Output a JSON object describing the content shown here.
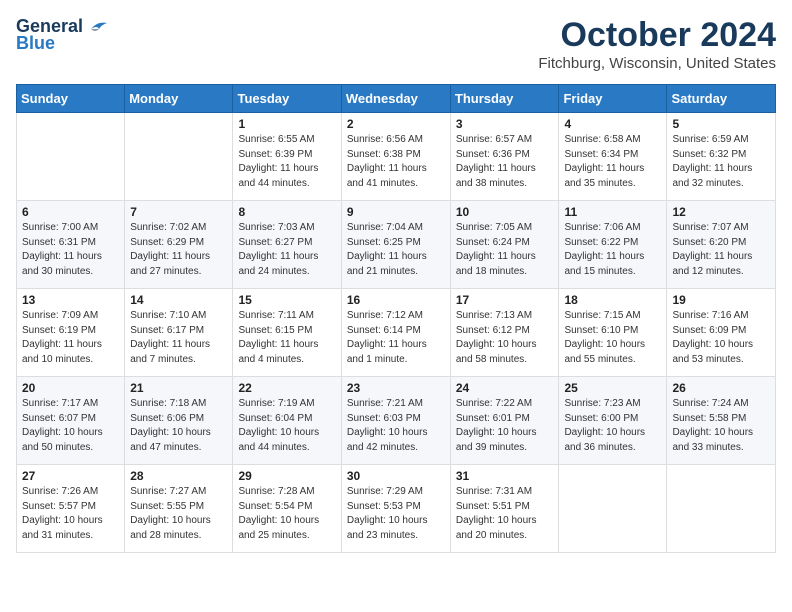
{
  "header": {
    "logo_general": "General",
    "logo_blue": "Blue",
    "month": "October 2024",
    "location": "Fitchburg, Wisconsin, United States"
  },
  "days_of_week": [
    "Sunday",
    "Monday",
    "Tuesday",
    "Wednesday",
    "Thursday",
    "Friday",
    "Saturday"
  ],
  "weeks": [
    [
      {
        "day": "",
        "sunrise": "",
        "sunset": "",
        "daylight": ""
      },
      {
        "day": "",
        "sunrise": "",
        "sunset": "",
        "daylight": ""
      },
      {
        "day": "1",
        "sunrise": "Sunrise: 6:55 AM",
        "sunset": "Sunset: 6:39 PM",
        "daylight": "Daylight: 11 hours and 44 minutes."
      },
      {
        "day": "2",
        "sunrise": "Sunrise: 6:56 AM",
        "sunset": "Sunset: 6:38 PM",
        "daylight": "Daylight: 11 hours and 41 minutes."
      },
      {
        "day": "3",
        "sunrise": "Sunrise: 6:57 AM",
        "sunset": "Sunset: 6:36 PM",
        "daylight": "Daylight: 11 hours and 38 minutes."
      },
      {
        "day": "4",
        "sunrise": "Sunrise: 6:58 AM",
        "sunset": "Sunset: 6:34 PM",
        "daylight": "Daylight: 11 hours and 35 minutes."
      },
      {
        "day": "5",
        "sunrise": "Sunrise: 6:59 AM",
        "sunset": "Sunset: 6:32 PM",
        "daylight": "Daylight: 11 hours and 32 minutes."
      }
    ],
    [
      {
        "day": "6",
        "sunrise": "Sunrise: 7:00 AM",
        "sunset": "Sunset: 6:31 PM",
        "daylight": "Daylight: 11 hours and 30 minutes."
      },
      {
        "day": "7",
        "sunrise": "Sunrise: 7:02 AM",
        "sunset": "Sunset: 6:29 PM",
        "daylight": "Daylight: 11 hours and 27 minutes."
      },
      {
        "day": "8",
        "sunrise": "Sunrise: 7:03 AM",
        "sunset": "Sunset: 6:27 PM",
        "daylight": "Daylight: 11 hours and 24 minutes."
      },
      {
        "day": "9",
        "sunrise": "Sunrise: 7:04 AM",
        "sunset": "Sunset: 6:25 PM",
        "daylight": "Daylight: 11 hours and 21 minutes."
      },
      {
        "day": "10",
        "sunrise": "Sunrise: 7:05 AM",
        "sunset": "Sunset: 6:24 PM",
        "daylight": "Daylight: 11 hours and 18 minutes."
      },
      {
        "day": "11",
        "sunrise": "Sunrise: 7:06 AM",
        "sunset": "Sunset: 6:22 PM",
        "daylight": "Daylight: 11 hours and 15 minutes."
      },
      {
        "day": "12",
        "sunrise": "Sunrise: 7:07 AM",
        "sunset": "Sunset: 6:20 PM",
        "daylight": "Daylight: 11 hours and 12 minutes."
      }
    ],
    [
      {
        "day": "13",
        "sunrise": "Sunrise: 7:09 AM",
        "sunset": "Sunset: 6:19 PM",
        "daylight": "Daylight: 11 hours and 10 minutes."
      },
      {
        "day": "14",
        "sunrise": "Sunrise: 7:10 AM",
        "sunset": "Sunset: 6:17 PM",
        "daylight": "Daylight: 11 hours and 7 minutes."
      },
      {
        "day": "15",
        "sunrise": "Sunrise: 7:11 AM",
        "sunset": "Sunset: 6:15 PM",
        "daylight": "Daylight: 11 hours and 4 minutes."
      },
      {
        "day": "16",
        "sunrise": "Sunrise: 7:12 AM",
        "sunset": "Sunset: 6:14 PM",
        "daylight": "Daylight: 11 hours and 1 minute."
      },
      {
        "day": "17",
        "sunrise": "Sunrise: 7:13 AM",
        "sunset": "Sunset: 6:12 PM",
        "daylight": "Daylight: 10 hours and 58 minutes."
      },
      {
        "day": "18",
        "sunrise": "Sunrise: 7:15 AM",
        "sunset": "Sunset: 6:10 PM",
        "daylight": "Daylight: 10 hours and 55 minutes."
      },
      {
        "day": "19",
        "sunrise": "Sunrise: 7:16 AM",
        "sunset": "Sunset: 6:09 PM",
        "daylight": "Daylight: 10 hours and 53 minutes."
      }
    ],
    [
      {
        "day": "20",
        "sunrise": "Sunrise: 7:17 AM",
        "sunset": "Sunset: 6:07 PM",
        "daylight": "Daylight: 10 hours and 50 minutes."
      },
      {
        "day": "21",
        "sunrise": "Sunrise: 7:18 AM",
        "sunset": "Sunset: 6:06 PM",
        "daylight": "Daylight: 10 hours and 47 minutes."
      },
      {
        "day": "22",
        "sunrise": "Sunrise: 7:19 AM",
        "sunset": "Sunset: 6:04 PM",
        "daylight": "Daylight: 10 hours and 44 minutes."
      },
      {
        "day": "23",
        "sunrise": "Sunrise: 7:21 AM",
        "sunset": "Sunset: 6:03 PM",
        "daylight": "Daylight: 10 hours and 42 minutes."
      },
      {
        "day": "24",
        "sunrise": "Sunrise: 7:22 AM",
        "sunset": "Sunset: 6:01 PM",
        "daylight": "Daylight: 10 hours and 39 minutes."
      },
      {
        "day": "25",
        "sunrise": "Sunrise: 7:23 AM",
        "sunset": "Sunset: 6:00 PM",
        "daylight": "Daylight: 10 hours and 36 minutes."
      },
      {
        "day": "26",
        "sunrise": "Sunrise: 7:24 AM",
        "sunset": "Sunset: 5:58 PM",
        "daylight": "Daylight: 10 hours and 33 minutes."
      }
    ],
    [
      {
        "day": "27",
        "sunrise": "Sunrise: 7:26 AM",
        "sunset": "Sunset: 5:57 PM",
        "daylight": "Daylight: 10 hours and 31 minutes."
      },
      {
        "day": "28",
        "sunrise": "Sunrise: 7:27 AM",
        "sunset": "Sunset: 5:55 PM",
        "daylight": "Daylight: 10 hours and 28 minutes."
      },
      {
        "day": "29",
        "sunrise": "Sunrise: 7:28 AM",
        "sunset": "Sunset: 5:54 PM",
        "daylight": "Daylight: 10 hours and 25 minutes."
      },
      {
        "day": "30",
        "sunrise": "Sunrise: 7:29 AM",
        "sunset": "Sunset: 5:53 PM",
        "daylight": "Daylight: 10 hours and 23 minutes."
      },
      {
        "day": "31",
        "sunrise": "Sunrise: 7:31 AM",
        "sunset": "Sunset: 5:51 PM",
        "daylight": "Daylight: 10 hours and 20 minutes."
      },
      {
        "day": "",
        "sunrise": "",
        "sunset": "",
        "daylight": ""
      },
      {
        "day": "",
        "sunrise": "",
        "sunset": "",
        "daylight": ""
      }
    ]
  ]
}
